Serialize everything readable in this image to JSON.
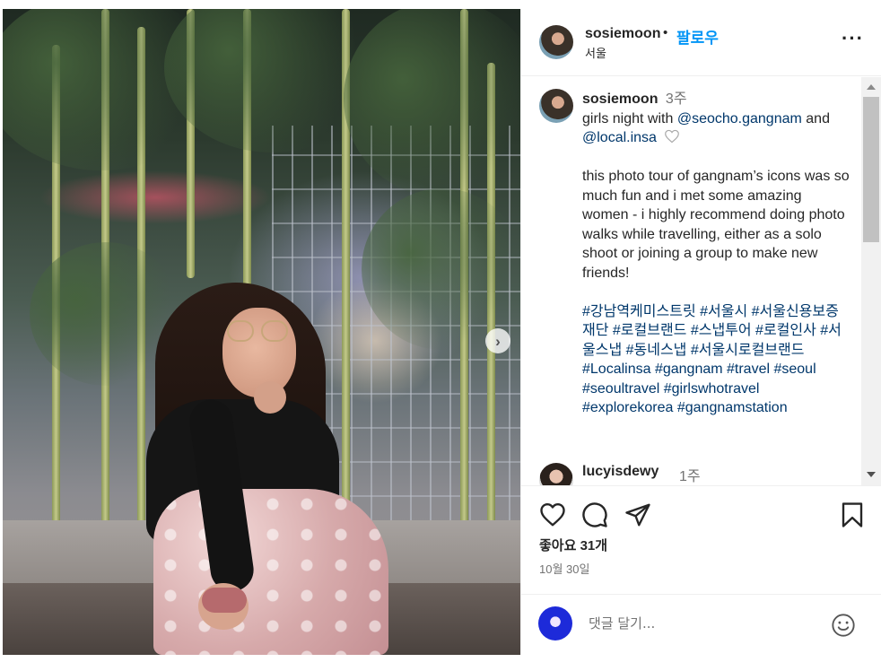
{
  "post": {
    "author": "sosiemoon",
    "follow_label": "팔로우",
    "separator": "•",
    "location": "서울",
    "more_label": "···"
  },
  "caption": {
    "author": "sosiemoon",
    "time": "3주",
    "line1": "girls night with ",
    "mention1": "@seocho.gangnam",
    "line1b": " and",
    "mention2": "@local.insa",
    "body": "this photo tour of gangnam’s icons was so much fun and i met some amazing women - i highly recommend doing photo walks while travelling, either as a solo shoot or joining a group to make new friends!",
    "hashtags": "#강남역케미스트릿 #서울시 #서울신용보증재단 #로컬브랜드 #스냅투어 #로컬인사 #서울스냅 #동네스냅 #서울시로컬브랜드 #Localinsa #gangnam #travel #seoul #seoultravel #girlswhotravel #explorekorea #gangnamstation"
  },
  "reply": {
    "author": "lucyisdewy",
    "time": "1주"
  },
  "stats": {
    "likes": "좋아요 31개",
    "date": "10월 30일"
  },
  "comment_box": {
    "placeholder": "댓글 달기..."
  },
  "icons": {
    "like": "heart-icon",
    "comment": "comment-icon",
    "share": "share-icon",
    "save": "bookmark-icon",
    "emoji": "emoji-icon",
    "next": "chevron-right-icon",
    "more": "more-icon"
  },
  "colors": {
    "link": "#00376b",
    "follow": "#0095f6",
    "muted": "#737373",
    "text": "#262626"
  }
}
